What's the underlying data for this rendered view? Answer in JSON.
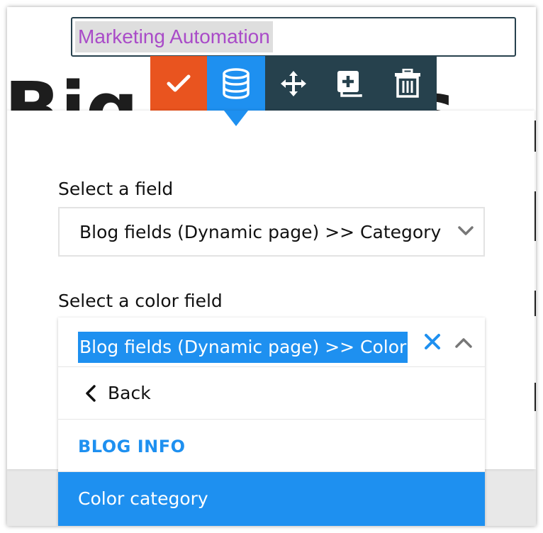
{
  "colors": {
    "accent_blue": "#1e90f0",
    "confirm_orange": "#e9541f",
    "toolbar_dark": "#26414d",
    "title_text_purple": "#a94bc8"
  },
  "title_field": {
    "value": "Marketing Automation"
  },
  "toolbar": {
    "buttons": [
      {
        "name": "confirm",
        "icon": "check-icon"
      },
      {
        "name": "dynamic-data",
        "icon": "database-icon"
      },
      {
        "name": "move",
        "icon": "move-arrows-icon"
      },
      {
        "name": "duplicate",
        "icon": "duplicate-icon"
      },
      {
        "name": "delete",
        "icon": "trash-icon"
      }
    ]
  },
  "panel": {
    "field_label": "Select a field",
    "field_value": "Blog fields (Dynamic page) >> Category",
    "color_label": "Select a color field",
    "color_value": "Blog fields (Dynamic page) >> Color",
    "dropdown": {
      "back_label": "Back",
      "group_label": "BLOG INFO",
      "options": [
        "Color category"
      ]
    }
  }
}
